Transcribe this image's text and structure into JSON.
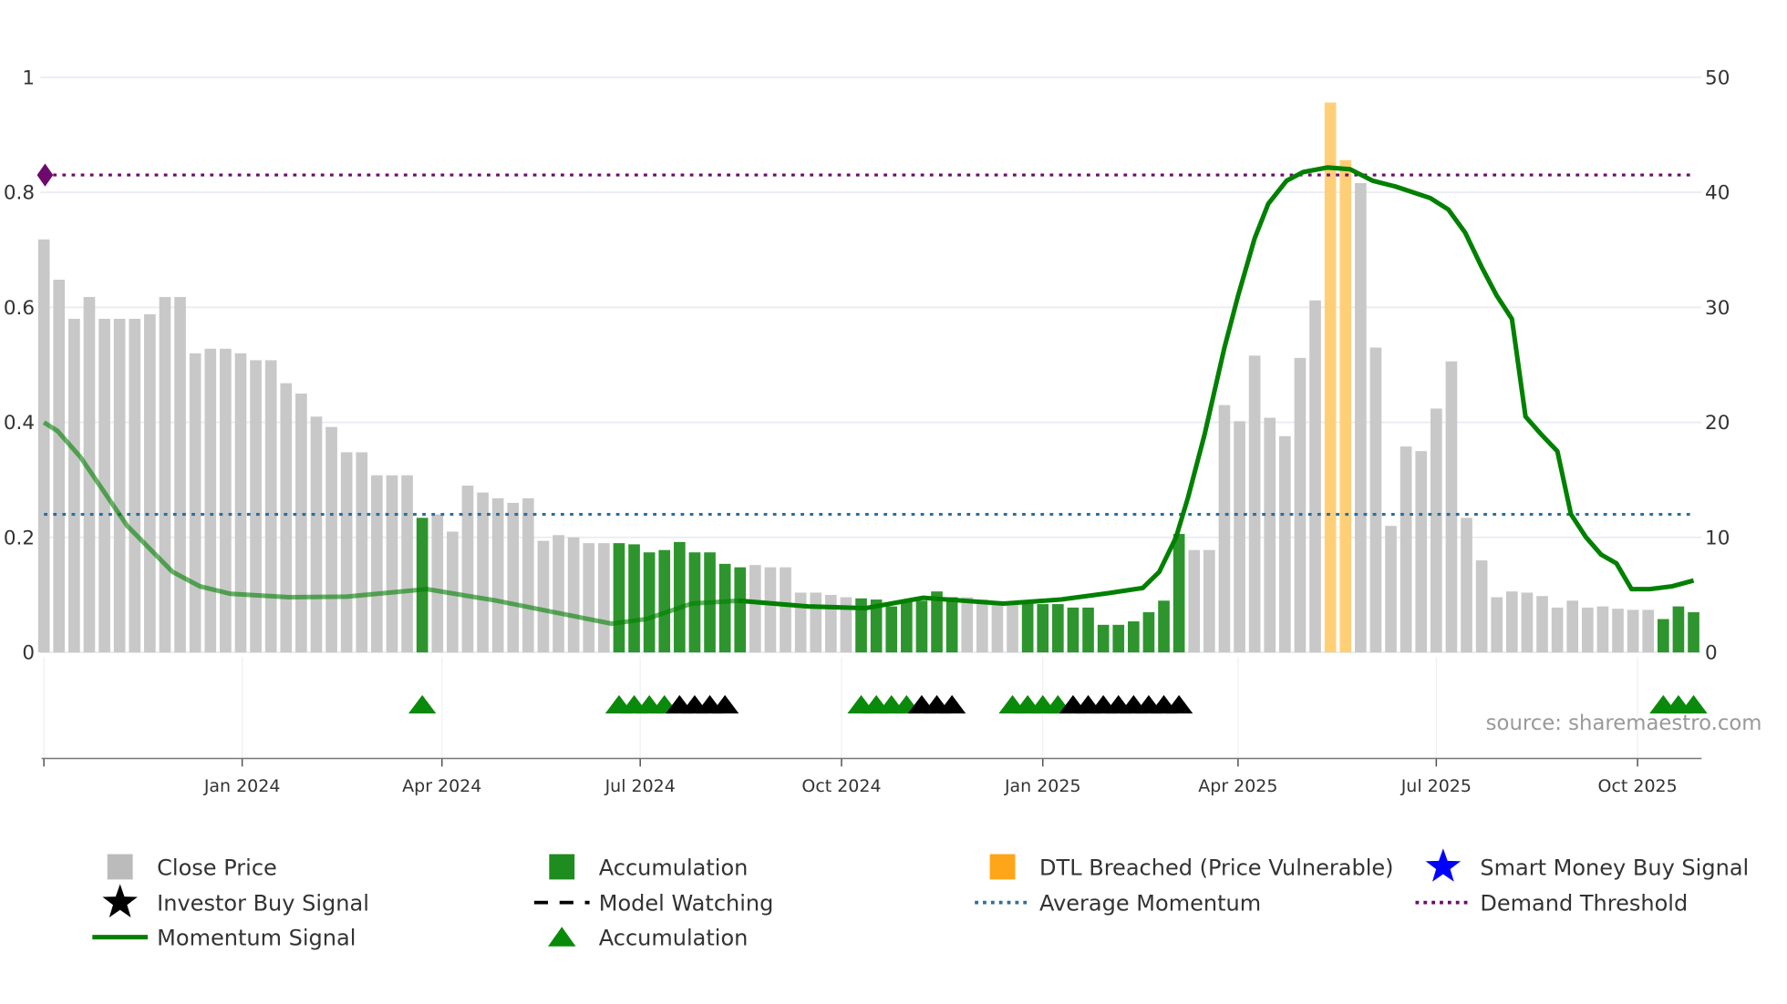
{
  "chart_data": {
    "type": "bar",
    "title": "",
    "xlabel": "",
    "ylabel_left": "",
    "ylabel_right": "",
    "y_left": {
      "range": [
        0,
        1
      ],
      "ticks": [
        "0",
        "0.2",
        "0.4",
        "0.6",
        "0.8",
        "1"
      ],
      "tick_values": [
        0,
        0.2,
        0.4,
        0.6,
        0.8,
        1
      ]
    },
    "y_right": {
      "range": [
        0,
        50
      ],
      "ticks": [
        "0",
        "10",
        "20",
        "30",
        "40",
        "50"
      ],
      "tick_values": [
        0,
        10,
        20,
        30,
        40,
        50
      ]
    },
    "x_unit": "week index",
    "x_ticks": [
      {
        "pos": 0,
        "label": ""
      },
      {
        "pos": 13.1,
        "label": "Jan 2024"
      },
      {
        "pos": 26.3,
        "label": "Apr 2024"
      },
      {
        "pos": 39.4,
        "label": "Jul 2024"
      },
      {
        "pos": 52.7,
        "label": "Oct 2024"
      },
      {
        "pos": 66.0,
        "label": "Jan 2025"
      },
      {
        "pos": 78.9,
        "label": "Apr 2025"
      },
      {
        "pos": 92.0,
        "label": "Jul 2025"
      },
      {
        "pos": 105.3,
        "label": "Oct 2025"
      }
    ],
    "grid": true,
    "bars": {
      "axis": "right",
      "values": [
        35.9,
        32.4,
        29.0,
        30.9,
        29.0,
        29.0,
        29.0,
        29.4,
        30.9,
        30.9,
        26.0,
        26.4,
        26.4,
        26.0,
        25.4,
        25.4,
        23.4,
        22.5,
        20.5,
        19.6,
        17.4,
        17.4,
        15.4,
        15.4,
        15.4,
        11.7,
        12.0,
        10.5,
        14.5,
        13.9,
        13.4,
        13.0,
        13.4,
        9.7,
        10.2,
        10.0,
        9.5,
        9.5,
        9.5,
        9.4,
        8.7,
        8.9,
        9.6,
        8.7,
        8.7,
        7.7,
        7.4,
        7.6,
        7.4,
        7.4,
        5.2,
        5.2,
        5.0,
        4.8,
        4.7,
        4.6,
        4.0,
        4.5,
        4.5,
        5.3,
        4.8,
        4.8,
        4.6,
        4.4,
        4.3,
        4.3,
        4.2,
        4.2,
        3.9,
        3.9,
        2.4,
        2.4,
        2.7,
        3.5,
        4.5,
        10.3,
        8.9,
        8.9,
        21.5,
        20.1,
        25.8,
        20.4,
        18.8,
        25.6,
        30.6,
        47.8,
        42.8,
        40.8,
        26.5,
        11.0,
        17.9,
        17.5,
        21.2,
        25.3,
        11.7,
        8.0,
        4.8,
        5.3,
        5.2,
        4.9,
        3.9,
        4.5,
        3.9,
        4.0,
        3.8,
        3.7,
        3.7,
        2.9,
        4.0,
        3.5
      ],
      "categories": [
        "close",
        "close",
        "close",
        "close",
        "close",
        "close",
        "close",
        "close",
        "close",
        "close",
        "close",
        "close",
        "close",
        "close",
        "close",
        "close",
        "close",
        "close",
        "close",
        "close",
        "close",
        "close",
        "close",
        "close",
        "close",
        "acc",
        "close",
        "close",
        "close",
        "close",
        "close",
        "close",
        "close",
        "close",
        "close",
        "close",
        "close",
        "close",
        "acc",
        "acc",
        "acc",
        "acc",
        "acc",
        "acc",
        "acc",
        "acc",
        "acc",
        "close",
        "close",
        "close",
        "close",
        "close",
        "close",
        "close",
        "acc",
        "acc",
        "acc",
        "acc",
        "acc",
        "acc",
        "acc",
        "close",
        "close",
        "close",
        "close",
        "acc",
        "acc",
        "acc",
        "acc",
        "acc",
        "acc",
        "acc",
        "acc",
        "acc",
        "acc",
        "acc",
        "close",
        "close",
        "close",
        "close",
        "close",
        "close",
        "close",
        "close",
        "close",
        "dtl",
        "dtl",
        "close",
        "close",
        "close",
        "close",
        "close",
        "close",
        "close",
        "close",
        "close",
        "close",
        "close",
        "close",
        "close",
        "close",
        "close",
        "close",
        "close",
        "close",
        "close",
        "close",
        "acc",
        "acc",
        "acc"
      ]
    },
    "momentum": {
      "axis": "left",
      "points": [
        [
          0,
          0.4
        ],
        [
          0.9,
          0.385
        ],
        [
          2.4,
          0.34
        ],
        [
          5.5,
          0.22
        ],
        [
          8.5,
          0.14
        ],
        [
          10.3,
          0.115
        ],
        [
          12.3,
          0.102
        ],
        [
          16.2,
          0.096
        ],
        [
          20,
          0.097
        ],
        [
          25.3,
          0.11
        ],
        [
          29.9,
          0.09
        ],
        [
          33.7,
          0.07
        ],
        [
          37.5,
          0.05
        ],
        [
          39.8,
          0.058
        ],
        [
          42.8,
          0.085
        ],
        [
          45.9,
          0.09
        ],
        [
          50.5,
          0.08
        ],
        [
          54.3,
          0.077
        ],
        [
          58.1,
          0.095
        ],
        [
          63.4,
          0.085
        ],
        [
          67.2,
          0.092
        ],
        [
          70.3,
          0.103
        ],
        [
          72.6,
          0.112
        ],
        [
          73.7,
          0.14
        ],
        [
          74.8,
          0.2
        ],
        [
          75.6,
          0.27
        ],
        [
          76.7,
          0.38
        ],
        [
          78,
          0.53
        ],
        [
          78.9,
          0.62
        ],
        [
          80,
          0.72
        ],
        [
          80.9,
          0.78
        ],
        [
          82.1,
          0.82
        ],
        [
          83.2,
          0.835
        ],
        [
          84.8,
          0.843
        ],
        [
          86.3,
          0.84
        ],
        [
          87.8,
          0.82
        ],
        [
          89.3,
          0.81
        ],
        [
          91.6,
          0.79
        ],
        [
          92.8,
          0.77
        ],
        [
          93.9,
          0.73
        ],
        [
          95,
          0.67
        ],
        [
          96,
          0.62
        ],
        [
          97,
          0.58
        ],
        [
          97.9,
          0.41
        ],
        [
          98.9,
          0.38
        ],
        [
          100,
          0.35
        ],
        [
          100.9,
          0.24
        ],
        [
          101.9,
          0.2
        ],
        [
          102.9,
          0.17
        ],
        [
          103.9,
          0.155
        ],
        [
          104.9,
          0.11
        ],
        [
          106.1,
          0.11
        ],
        [
          107.6,
          0.115
        ],
        [
          109,
          0.125
        ]
      ],
      "faded_until": 46
    },
    "average_momentum": 0.24,
    "demand_threshold": 0.83,
    "signals": [
      {
        "i": 25,
        "type": "acc"
      },
      {
        "i": 38,
        "type": "acc"
      },
      {
        "i": 39,
        "type": "acc"
      },
      {
        "i": 40,
        "type": "acc"
      },
      {
        "i": 41,
        "type": "acc"
      },
      {
        "i": 42,
        "type": "watch"
      },
      {
        "i": 43,
        "type": "watch"
      },
      {
        "i": 44,
        "type": "watch"
      },
      {
        "i": 45,
        "type": "watch"
      },
      {
        "i": 54,
        "type": "acc"
      },
      {
        "i": 55,
        "type": "acc"
      },
      {
        "i": 56,
        "type": "acc"
      },
      {
        "i": 57,
        "type": "acc"
      },
      {
        "i": 58,
        "type": "watch"
      },
      {
        "i": 59,
        "type": "watch"
      },
      {
        "i": 60,
        "type": "watch"
      },
      {
        "i": 64,
        "type": "acc"
      },
      {
        "i": 65,
        "type": "acc"
      },
      {
        "i": 66,
        "type": "acc"
      },
      {
        "i": 67,
        "type": "acc"
      },
      {
        "i": 68,
        "type": "watch"
      },
      {
        "i": 69,
        "type": "watch"
      },
      {
        "i": 70,
        "type": "watch"
      },
      {
        "i": 71,
        "type": "watch"
      },
      {
        "i": 72,
        "type": "watch"
      },
      {
        "i": 73,
        "type": "watch"
      },
      {
        "i": 74,
        "type": "watch"
      },
      {
        "i": 75,
        "type": "watch"
      },
      {
        "i": 107,
        "type": "acc"
      },
      {
        "i": 108,
        "type": "acc"
      },
      {
        "i": 109,
        "type": "acc"
      }
    ],
    "colors": {
      "close": "#c8c8c8",
      "acc": "#2e952e",
      "dtl": "#ffcf78",
      "momentum": "#008000",
      "avg": "#2a6f9e",
      "threshold": "#6e0a6e",
      "signal_acc": "#0a8a0a",
      "signal_watch": "#000000",
      "smart": "#0000ff"
    },
    "legend": {
      "placement": "bottom",
      "items": [
        {
          "label": "Close Price",
          "icon": "gray-square"
        },
        {
          "label": "Accumulation",
          "icon": "green-square"
        },
        {
          "label": "DTL Breached (Price Vulnerable)",
          "icon": "orange-square"
        },
        {
          "label": "Smart Money Buy Signal",
          "icon": "blue-star"
        },
        {
          "label": "Investor Buy Signal",
          "icon": "black-star"
        },
        {
          "label": "Model Watching",
          "icon": "black-dash"
        },
        {
          "label": "Average Momentum",
          "icon": "blue-dots"
        },
        {
          "label": "Demand Threshold",
          "icon": "purple-dots"
        },
        {
          "label": "Momentum Signal",
          "icon": "green-line"
        },
        {
          "label": "Accumulation",
          "icon": "green-triangle"
        }
      ]
    },
    "source": "source: sharemaestro.com"
  }
}
